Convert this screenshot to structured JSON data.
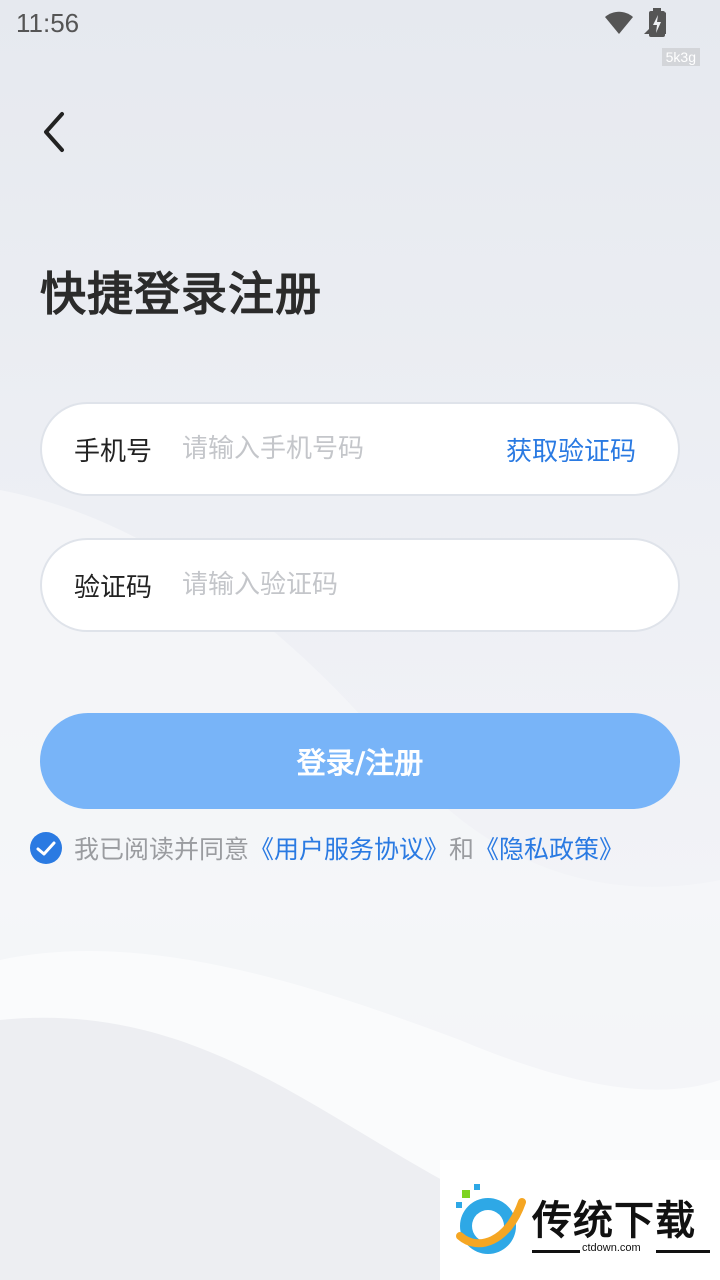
{
  "status_bar": {
    "time": "11:56",
    "network_badge": "5k3g"
  },
  "header": {
    "title": "快捷登录注册"
  },
  "phone_field": {
    "label": "手机号",
    "placeholder": "请输入手机号码",
    "value": "",
    "action_label": "获取验证码"
  },
  "code_field": {
    "label": "验证码",
    "placeholder": "请输入验证码",
    "value": ""
  },
  "login_button": {
    "label": "登录/注册"
  },
  "agreement": {
    "checked": true,
    "prefix": "我已阅读并同意",
    "terms_link": "《用户服务协议》",
    "conjunction": "和",
    "privacy_link": "《隐私政策》"
  },
  "watermark": {
    "brand": "传统下载",
    "site": "ctdown.com"
  },
  "colors": {
    "accent": "#2a7ae2",
    "button": "#78b4f8",
    "placeholder": "#c4c6ca"
  },
  "icons": {
    "back": "chevron-left-icon",
    "wifi": "wifi-icon",
    "signal": "signal-icon",
    "battery": "battery-charging-icon",
    "check": "check-icon"
  }
}
